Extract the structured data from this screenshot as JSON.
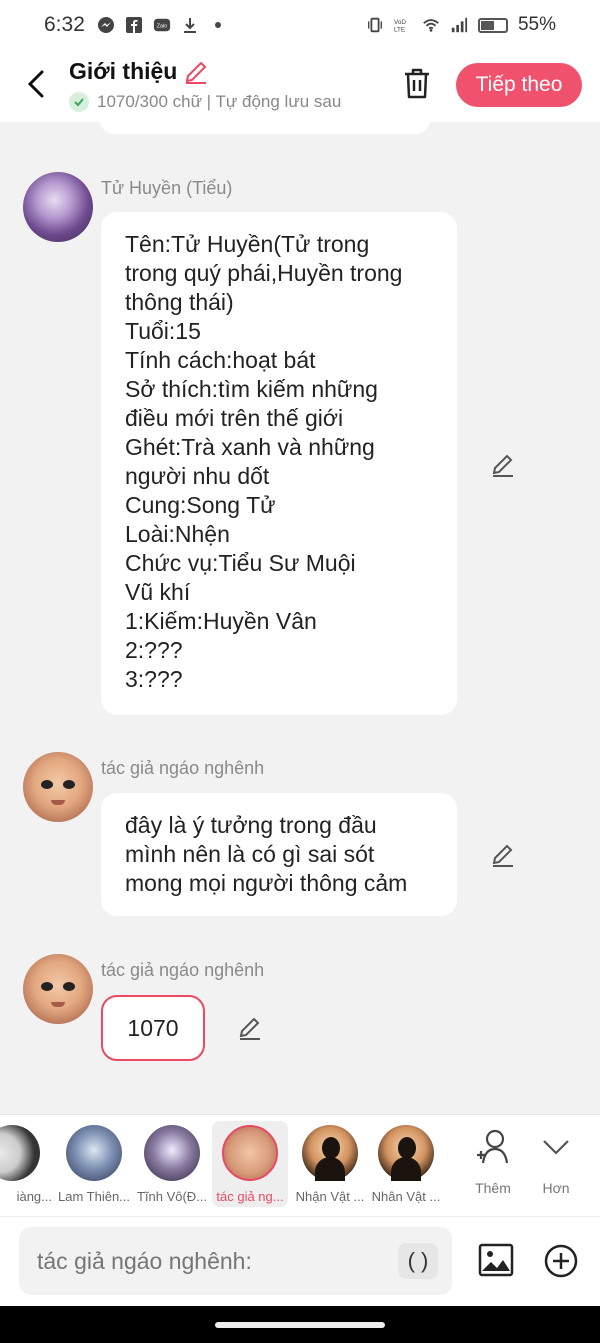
{
  "status_bar": {
    "time": "6:32",
    "battery": "55%"
  },
  "header": {
    "title": "Giới thiệu",
    "subtitle": "1070/300 chữ | Tự động lưu sau",
    "next_label": "Tiếp theo"
  },
  "messages": [
    {
      "sender": "Tử Huyền (Tiểu)",
      "lines": [
        "Tên:Tử Huyền(Tử trong",
        "trong quý phái,Huyền trong",
        "thông thái)",
        "Tuổi:15",
        "Tính cách:hoạt bát",
        "Sở thích:tìm kiếm những",
        "điều mới trên thế giới",
        "Ghét:Trà xanh và những",
        "người nhu dốt",
        "Cung:Song Tử",
        "Loài:Nhện",
        "Chức vụ:Tiểu Sư Muội",
        "Vũ khí",
        "1:Kiếm:Huyền Vân",
        "2:???",
        "3:???"
      ]
    },
    {
      "sender": "tác giả ngáo nghênh",
      "lines": [
        "đây là ý tưởng trong đầu",
        "mình nên là có gì sai sót",
        "mong mọi người thông cảm"
      ]
    },
    {
      "sender": "tác giả ngáo nghênh",
      "lines": [
        "1070"
      ]
    }
  ],
  "characters": [
    {
      "label": "iàng..."
    },
    {
      "label": "Lam Thiên..."
    },
    {
      "label": "Tĩnh Vô(Đ..."
    },
    {
      "label": "tác giả ng..."
    },
    {
      "label": "Nhận Vật ..."
    },
    {
      "label": "Nhân Vật ..."
    }
  ],
  "tools": {
    "add_label": "Thêm",
    "more_label": "Hơn"
  },
  "input": {
    "placeholder": "tác giả ngáo nghênh:",
    "paren_label": "( )"
  },
  "colors": {
    "accent": "#f0516c",
    "selected_outline": "#e94a62"
  }
}
